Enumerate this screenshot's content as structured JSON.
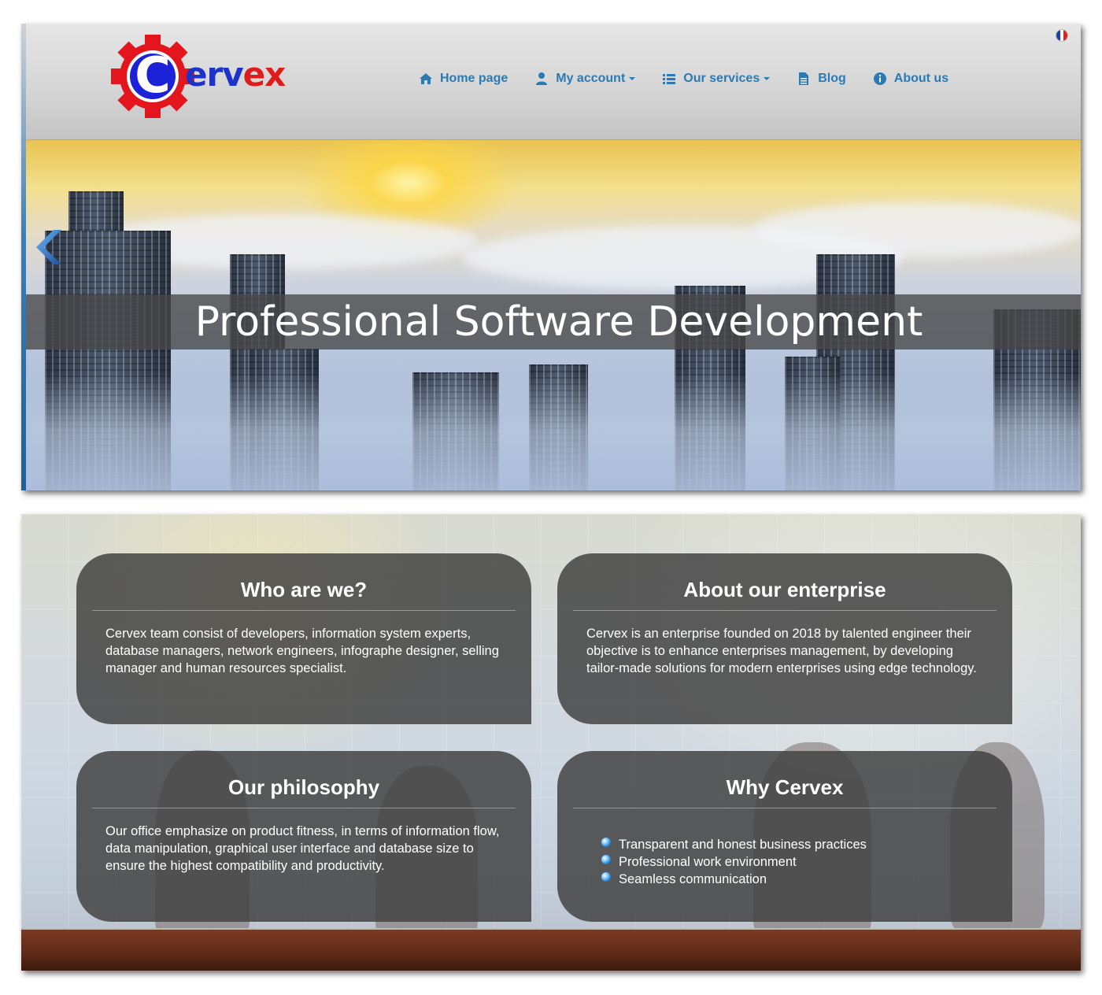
{
  "header": {
    "logo": {
      "letter": "C",
      "rest_blue": "erv",
      "rest_red": "ex",
      "name": "Cervex"
    },
    "nav": [
      {
        "label": "Home page",
        "icon": "home-icon",
        "dropdown": false
      },
      {
        "label": "My account",
        "icon": "user-icon",
        "dropdown": true
      },
      {
        "label": "Our services",
        "icon": "list-icon",
        "dropdown": true
      },
      {
        "label": "Blog",
        "icon": "document-icon",
        "dropdown": false
      },
      {
        "label": "About us",
        "icon": "info-icon",
        "dropdown": false
      }
    ],
    "language_flag": "french-flag-icon"
  },
  "hero": {
    "title": "Professional Software Development",
    "prev_icon": "chevron-left-icon"
  },
  "cards": [
    {
      "title": "Who are we?",
      "text": "Cervex team consist of developers, information system experts, database managers, network engineers, infographe designer, selling manager and human resources specialist."
    },
    {
      "title": "About our enterprise",
      "text": "Cervex is an enterprise founded on 2018 by talented engineer their objective is to enhance enterprises management, by developing tailor-made solutions for modern enterprises using edge technology."
    },
    {
      "title": "Our philosophy",
      "text": "Our office emphasize on product fitness, in terms of information flow, data manipulation, graphical user interface and database size to ensure the highest compatibility and productivity."
    },
    {
      "title": "Why Cervex",
      "items": [
        "Transparent and honest business practices",
        "Professional work environment",
        "Seamless communication"
      ]
    }
  ],
  "colors": {
    "nav_link": "#2a7ab4",
    "logo_blue": "#1b33c8",
    "logo_red": "#e01b1b",
    "card_bg": "#444444"
  }
}
